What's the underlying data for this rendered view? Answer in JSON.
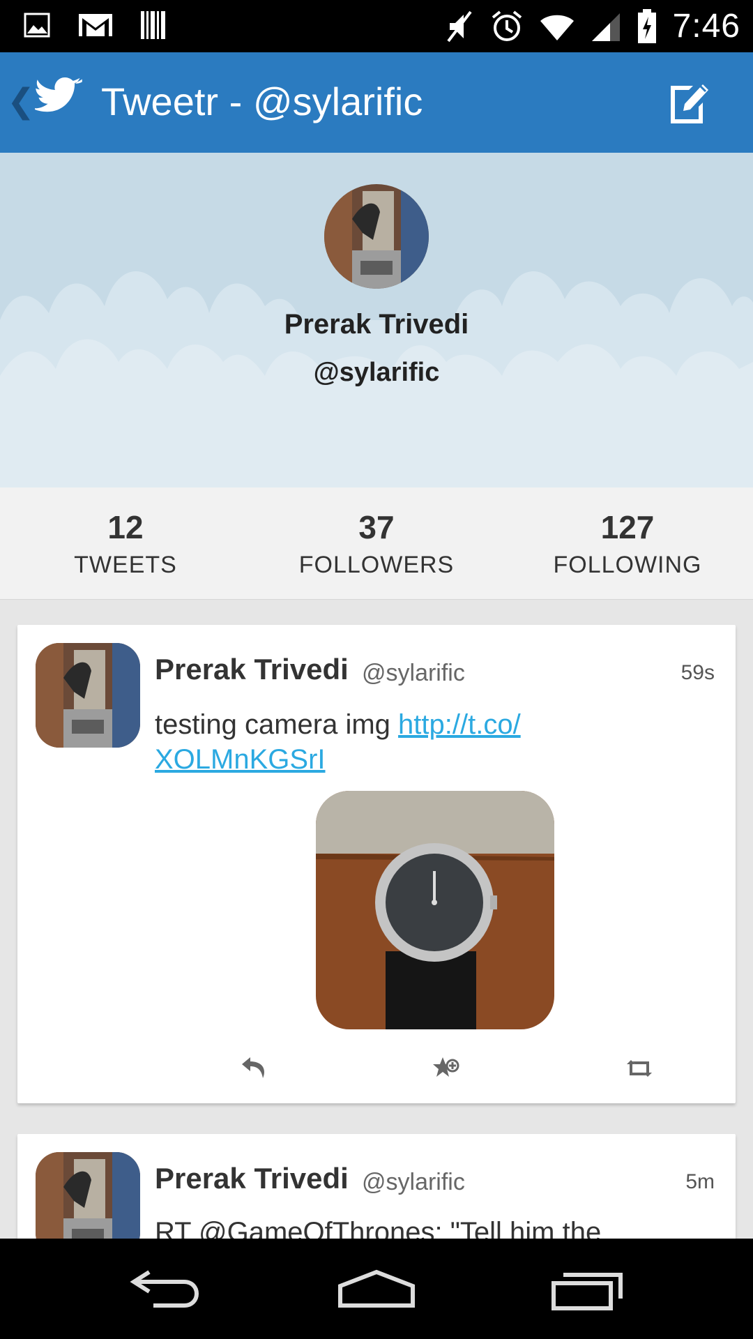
{
  "status_bar": {
    "time": "7:46",
    "left_icons": [
      "image-icon",
      "gmail-icon",
      "barcode-icon"
    ],
    "right_icons": [
      "mute-icon",
      "alarm-icon",
      "wifi-icon",
      "signal-icon",
      "battery-icon"
    ]
  },
  "action_bar": {
    "title": "Tweetr - @sylarific",
    "back_icon": "chevron-left-icon",
    "logo_icon": "twitter-bird-icon",
    "compose_icon": "compose-icon",
    "color": "#2b7bc0"
  },
  "profile": {
    "name": "Prerak Trivedi",
    "handle": "@sylarific"
  },
  "stats": [
    {
      "value": "12",
      "label": "TWEETS"
    },
    {
      "value": "37",
      "label": "FOLLOWERS"
    },
    {
      "value": "127",
      "label": "FOLLOWING"
    }
  ],
  "tweets": [
    {
      "name": "Prerak Trivedi",
      "handle": "@sylarific",
      "time": "59s",
      "text": "testing camera img ",
      "link_line1": "http://t.co/",
      "link_line2": "XOLMnKGSrI",
      "actions": [
        "reply-icon",
        "favorite-icon",
        "retweet-icon"
      ]
    },
    {
      "name": "Prerak Trivedi",
      "handle": "@sylarific",
      "time": "5m",
      "text": "RT @GameOfThrones: \"Tell him the"
    }
  ],
  "nav_bar": {
    "buttons": [
      "back-icon",
      "home-icon",
      "recents-icon"
    ]
  }
}
